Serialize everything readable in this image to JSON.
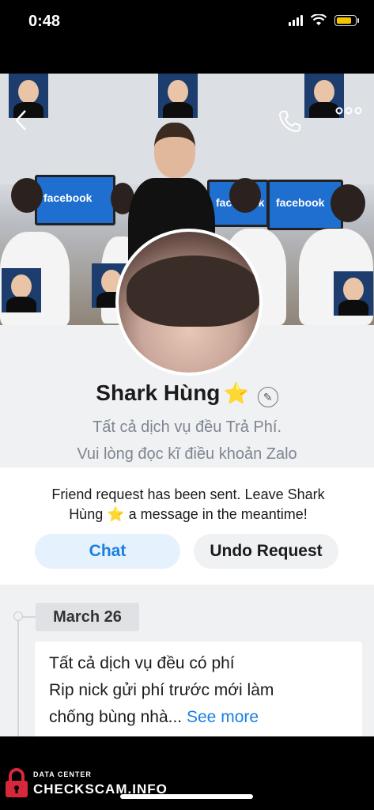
{
  "status_bar": {
    "time": "0:48"
  },
  "colors": {
    "accent": "#1a7fe0",
    "chat_bg": "#e5f1fc",
    "star": "#f6c12f"
  },
  "nav": {
    "back_icon": "chevron-left-icon",
    "phone_icon": "phone-icon",
    "more_icon": "more-horizontal-icon"
  },
  "cover": {
    "monitor_text": "facebook"
  },
  "profile": {
    "name": "Shark Hùng",
    "star": "⭐",
    "bio_line1": "Tất cả dịch vụ đều Trả Phí.",
    "bio_line2": "Vui lòng đọc kĩ điều khoản Zalo"
  },
  "request": {
    "message_line1": "Friend request has been sent. Leave Shark",
    "message_line2_a": "Hùng",
    "message_line2_b": "a message in the meantime!",
    "chat_label": "Chat",
    "undo_label": "Undo Request"
  },
  "timeline": {
    "date": "March 26",
    "post_line1": "Tất cả dịch vụ đều có phí",
    "post_line2": "Rip nick gửi phí trước mới làm",
    "post_line3": "chống bùng nhà...",
    "see_more": "See more"
  },
  "watermark": {
    "small": "DATA CENTER",
    "big": "CHECKSCAM.INFO"
  }
}
